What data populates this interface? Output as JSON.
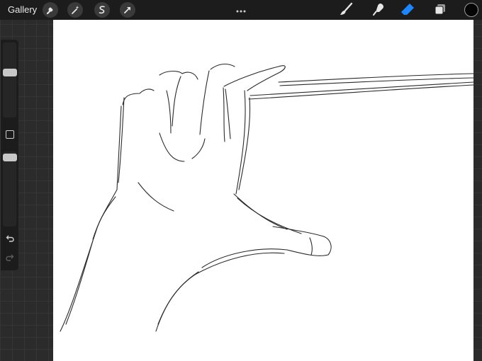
{
  "topbar": {
    "gallery_label": "Gallery",
    "left_buttons": [
      "wrench-icon",
      "magic-wand-icon",
      "selection-icon",
      "transform-arrow-icon"
    ],
    "center_menu": "more-dots-icon",
    "tools": [
      "brush-icon",
      "smudge-icon",
      "eraser-icon",
      "layers-icon"
    ],
    "active_tool": "eraser-icon",
    "active_tool_color": "#1e86ff",
    "current_color": "#050505"
  },
  "sidebar": {
    "brush_size_level": 0.55,
    "opacity_level": 0.95,
    "modify_button": "square-icon",
    "undo": "undo-icon",
    "redo": "redo-icon"
  },
  "canvas": {
    "background": "#ffffff",
    "content": "pencil-sketch"
  }
}
